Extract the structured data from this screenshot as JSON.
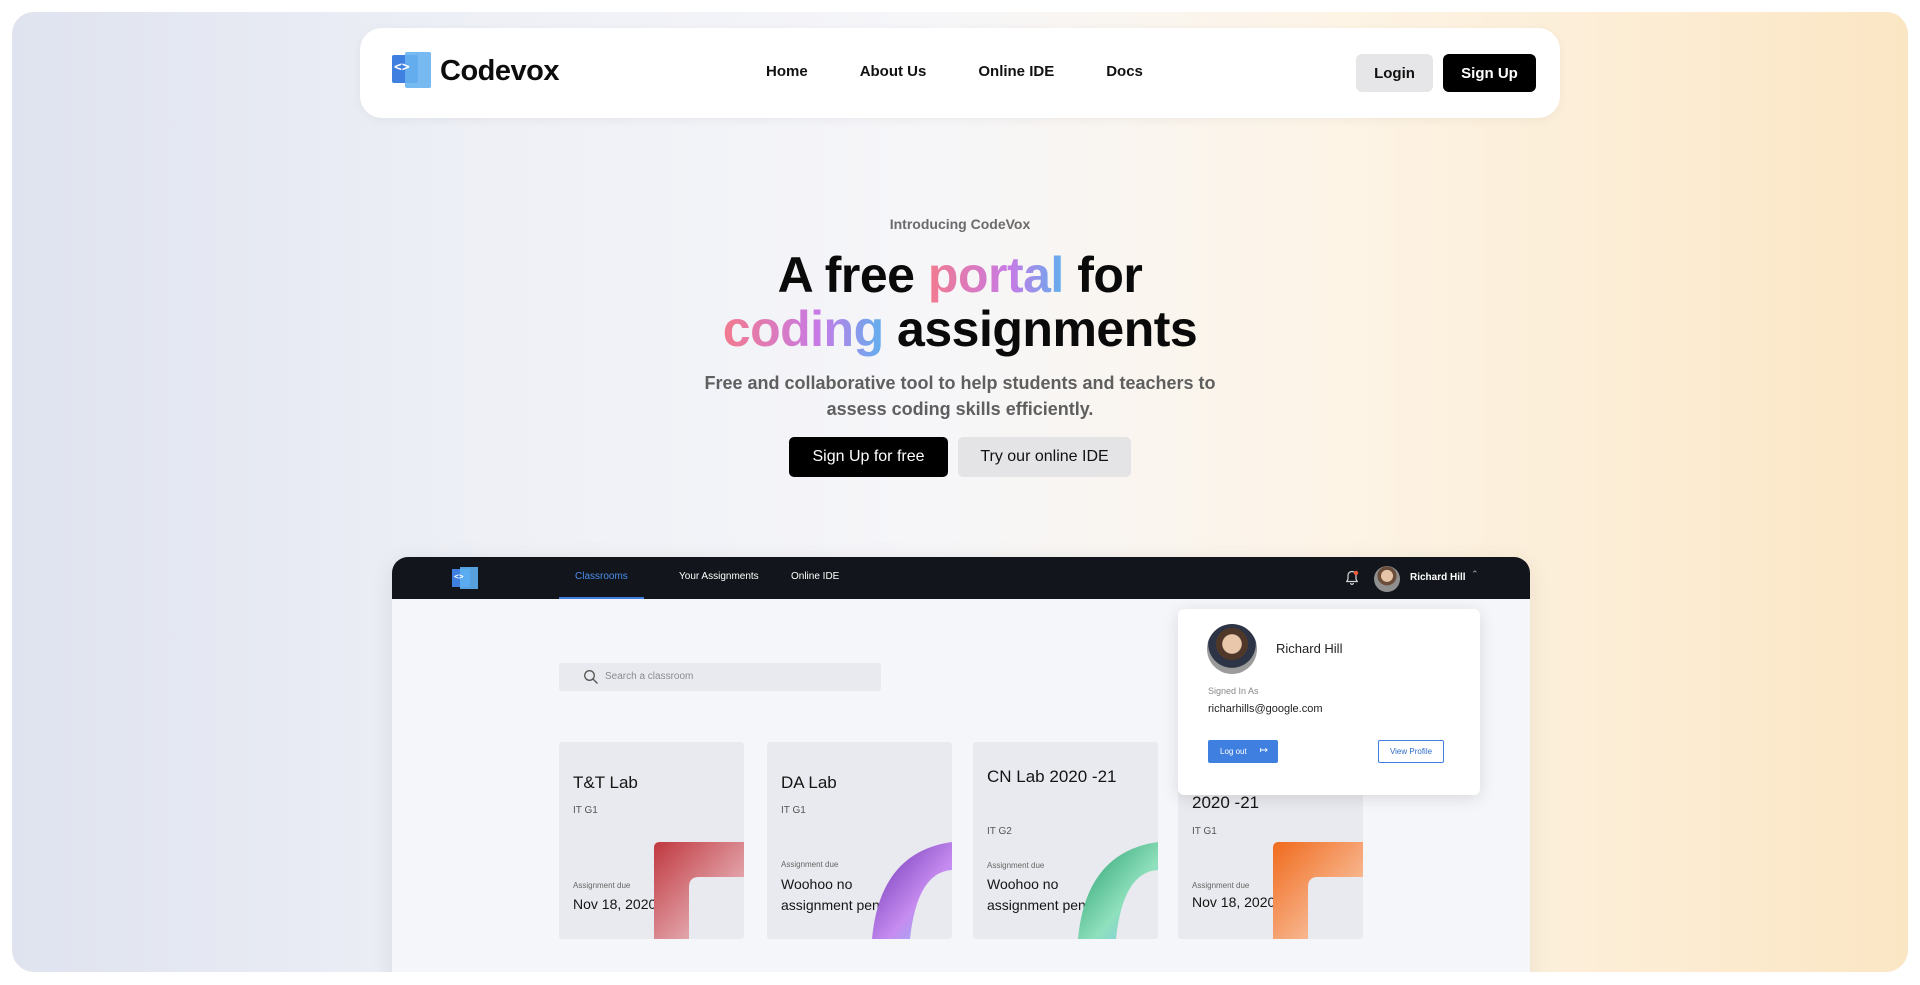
{
  "brand": {
    "name": "Codevox",
    "logo_icon": "code-brackets-icon"
  },
  "nav": {
    "links": [
      "Home",
      "About Us",
      "Online IDE",
      "Docs"
    ],
    "login_label": "Login",
    "signup_label": "Sign Up"
  },
  "hero": {
    "intro": "Introducing CodeVox",
    "headline": {
      "line1_a": "A free",
      "line1_highlight": "portal",
      "line1_b": "for",
      "line2_highlight": "coding",
      "line2_b": "assignments"
    },
    "subtitle_line1": "Free and collaborative tool to help students and teachers to",
    "subtitle_line2": "assess coding skills efficiently.",
    "primary_cta": "Sign Up for free",
    "secondary_cta": "Try our online IDE"
  },
  "preview": {
    "tabs": [
      "Classrooms",
      "Your Assignments",
      "Online IDE"
    ],
    "active_tab": "Classrooms",
    "user_name": "Richard Hill",
    "search_placeholder": "Search a classroom",
    "cards": [
      {
        "title": "T&T Lab",
        "class": "IT G1",
        "due_label": "Assignment due",
        "due": "Nov 18, 2020"
      },
      {
        "title": "DA Lab",
        "class": "IT G1",
        "due_label": "Assignment due",
        "due": "Woohoo no assignment pending"
      },
      {
        "title": "CN Lab 2020 -21",
        "class": "IT G2",
        "due_label": "Assignment due",
        "due": "Woohoo no assignment pending"
      },
      {
        "title": "2020 -21",
        "class": "IT G1",
        "due_label": "Assignment due",
        "due": "Nov 18, 2020"
      }
    ],
    "dropdown": {
      "name": "Richard Hill",
      "signed_in_label": "Signed In As",
      "email": "richarhills@google.com",
      "logout_label": "Log out",
      "view_profile_label": "View Profile"
    }
  },
  "colors": {
    "accent": "#3f7fe0",
    "navbar_dark": "#12151b"
  }
}
